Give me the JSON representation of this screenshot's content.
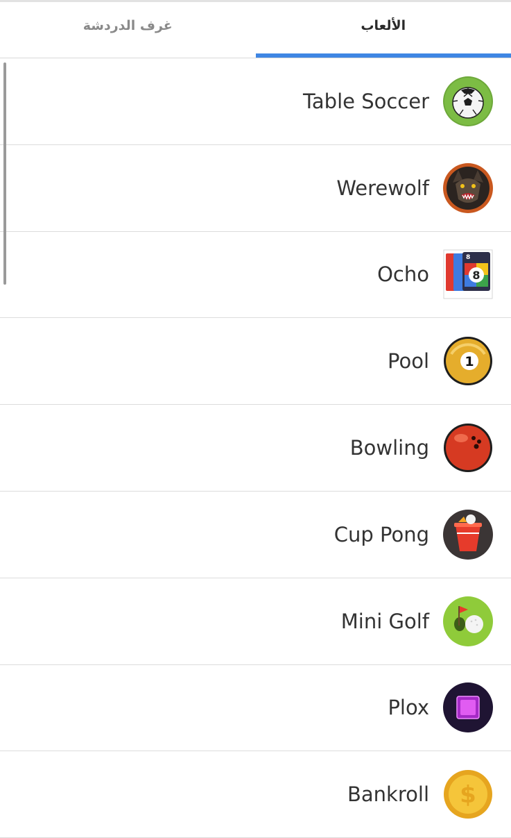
{
  "tabs": [
    {
      "label": "الألعاب",
      "active": true
    },
    {
      "label": "غرف الدردشة",
      "active": false
    }
  ],
  "games": [
    {
      "name": "Table Soccer",
      "icon": "soccer-ball-icon"
    },
    {
      "name": "Werewolf",
      "icon": "werewolf-icon"
    },
    {
      "name": "Ocho",
      "icon": "ocho-cards-icon"
    },
    {
      "name": "Pool",
      "icon": "pool-ball-icon"
    },
    {
      "name": "Bowling",
      "icon": "bowling-ball-icon"
    },
    {
      "name": "Cup Pong",
      "icon": "cup-pong-icon"
    },
    {
      "name": "Mini Golf",
      "icon": "mini-golf-icon"
    },
    {
      "name": "Plox",
      "icon": "plox-icon"
    },
    {
      "name": "Bankroll",
      "icon": "bankroll-coin-icon"
    }
  ],
  "colors": {
    "accent": "#3f86e3",
    "divider": "#dcdcdc",
    "text": "#333333",
    "inactive_tab": "#8a8a8a"
  }
}
